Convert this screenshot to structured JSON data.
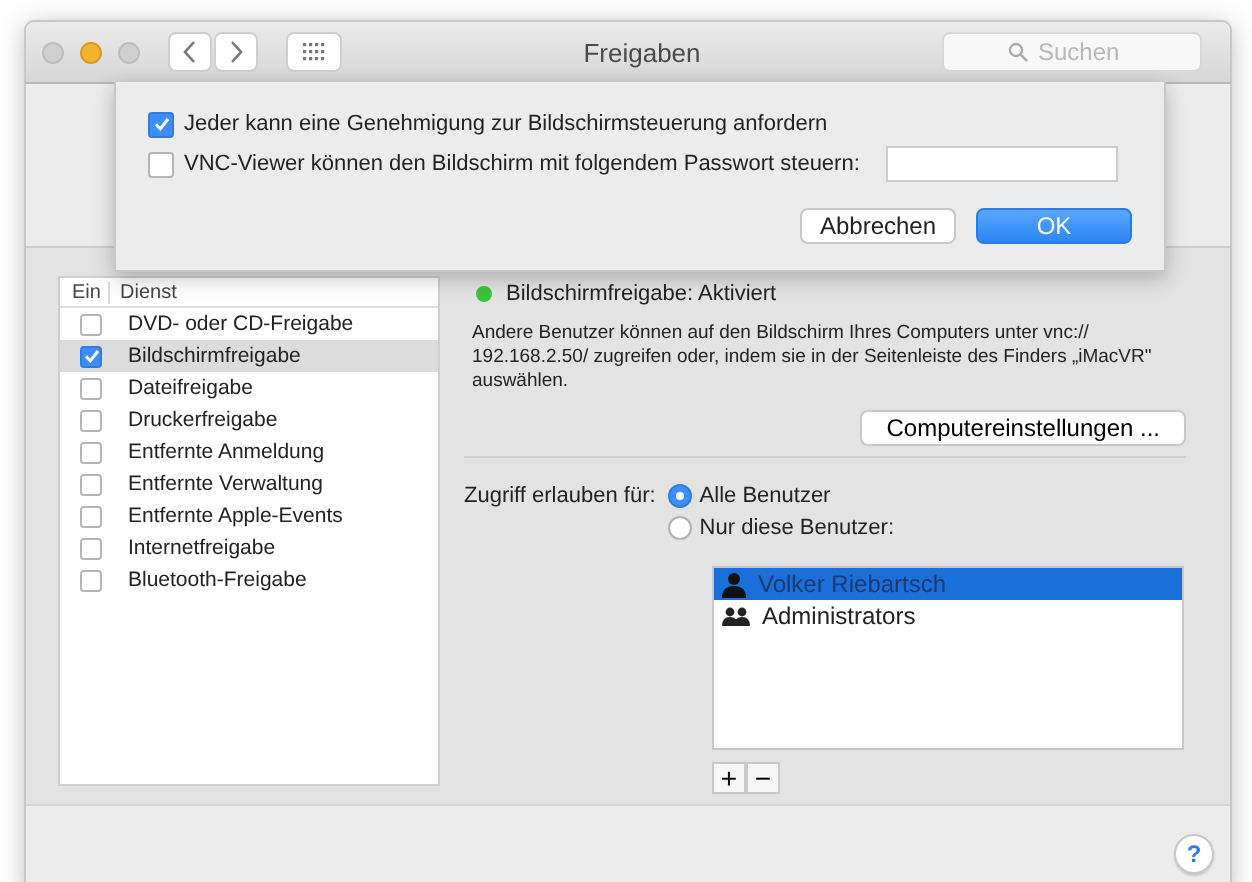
{
  "window": {
    "title": "Freigaben",
    "search": {
      "placeholder": "Suchen"
    }
  },
  "sheet": {
    "options": [
      {
        "kind": "checkbox",
        "label": "Jeder kann eine Genehmigung zur Bildschirmsteuerung anfordern",
        "checked": true
      },
      {
        "kind": "password",
        "label": "VNC-Viewer können den Bildschirm mit folgendem Passwort steuern:",
        "checked": false
      }
    ],
    "buttons": [
      {
        "label": "Abbrechen",
        "default": false
      },
      {
        "label": "OK",
        "default": true
      }
    ]
  },
  "services": {
    "columns": [
      "Ein",
      "Dienst"
    ],
    "items": [
      {
        "name": "DVD- oder CD-Freigabe",
        "on": false,
        "selected": false
      },
      {
        "name": "Bildschirmfreigabe",
        "on": true,
        "selected": true
      },
      {
        "name": "Dateifreigabe",
        "on": false,
        "selected": false
      },
      {
        "name": "Druckerfreigabe",
        "on": false,
        "selected": false
      },
      {
        "name": "Entfernte Anmeldung",
        "on": false,
        "selected": false
      },
      {
        "name": "Entfernte Verwaltung",
        "on": false,
        "selected": false
      },
      {
        "name": "Entfernte Apple-Events",
        "on": false,
        "selected": false
      },
      {
        "name": "Internetfreigabe",
        "on": false,
        "selected": false
      },
      {
        "name": "Bluetooth-Freigabe",
        "on": false,
        "selected": false
      }
    ]
  },
  "status": {
    "text": "Bildschirmfreigabe: Aktiviert",
    "on": true
  },
  "description": "Andere Benutzer können auf den Bildschirm Ihres Computers unter vnc:// 192.168.2.50/ zugreifen oder, indem sie in der Seitenleiste des Finders „iMacVR\" auswählen.",
  "settings_button": "Computereinstellungen ...",
  "access": {
    "label": "Zugriff erlauben für:",
    "options": [
      {
        "label": "Alle Benutzer",
        "selected": true
      },
      {
        "label": "Nur diese Benutzer:",
        "selected": false
      }
    ],
    "users": [
      {
        "kind": "user",
        "name": "Volker Riebartsch",
        "selected": true
      },
      {
        "kind": "group",
        "name": "Administrators",
        "selected": false
      }
    ],
    "add": "+",
    "remove": "−"
  },
  "help": "?"
}
